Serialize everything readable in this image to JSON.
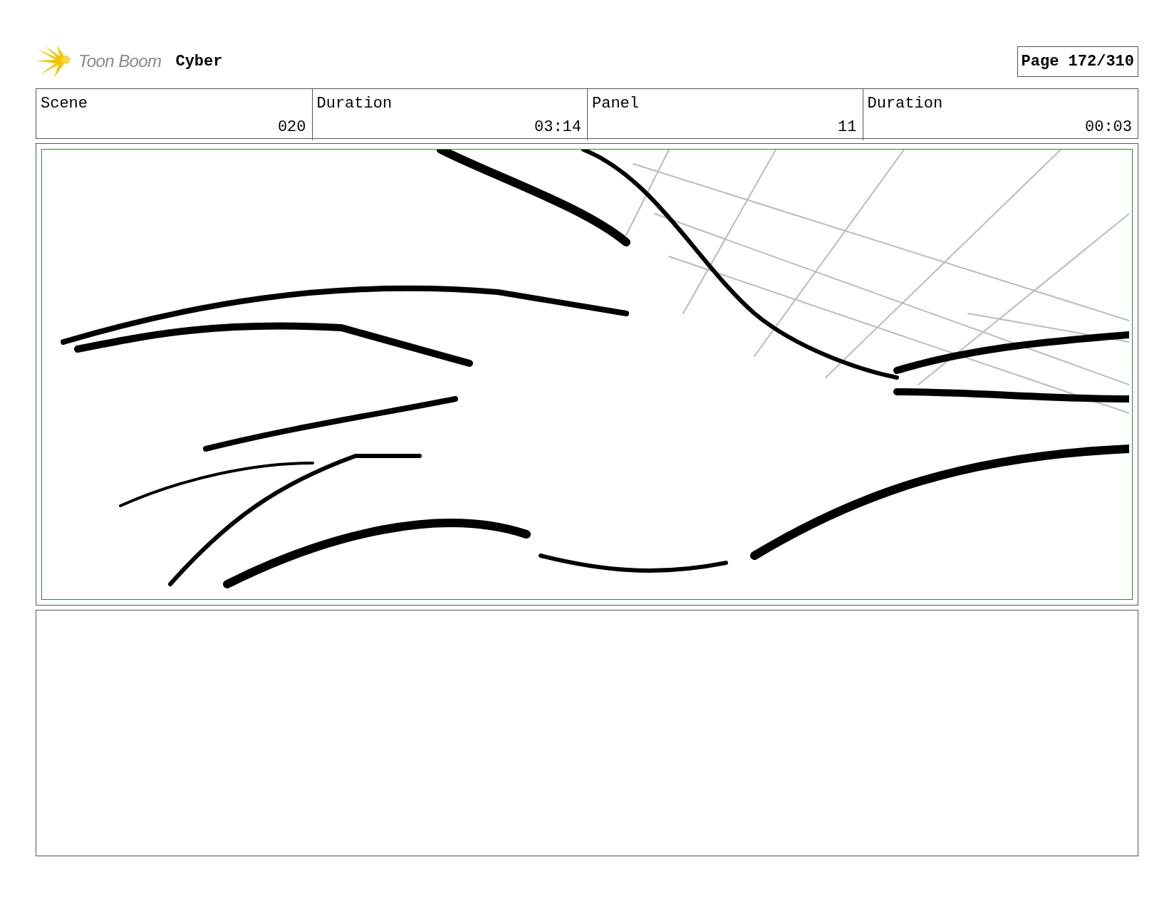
{
  "header": {
    "brand": "Toon Boom",
    "project": "Cyber",
    "page": "Page 172/310"
  },
  "info_table": {
    "labels": [
      "Scene",
      "Duration",
      "Panel",
      "Duration"
    ],
    "values": [
      "020",
      "03:14",
      "11",
      "00:03"
    ]
  }
}
